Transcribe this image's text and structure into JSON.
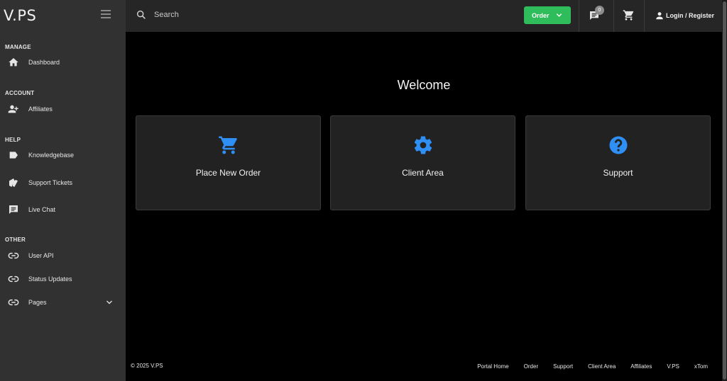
{
  "brand": "V.PS",
  "sidebar": {
    "sections": [
      {
        "label": "MANAGE",
        "items": [
          {
            "label": "Dashboard",
            "icon": "home-icon"
          }
        ]
      },
      {
        "label": "ACCOUNT",
        "items": [
          {
            "label": "Affiliates",
            "icon": "users-add-icon"
          }
        ]
      },
      {
        "label": "HELP",
        "items": [
          {
            "label": "Knowledgebase",
            "icon": "label-icon"
          },
          {
            "label": "Support Tickets",
            "icon": "ticket-icon"
          },
          {
            "label": "Live Chat",
            "icon": "chat-icon"
          }
        ]
      },
      {
        "label": "OTHER",
        "items": [
          {
            "label": "User API",
            "icon": "link-icon"
          },
          {
            "label": "Status Updates",
            "icon": "link-icon"
          },
          {
            "label": "Pages",
            "icon": "link-icon",
            "expandable": true
          }
        ]
      }
    ]
  },
  "topbar": {
    "search_placeholder": "Search",
    "order_label": "Order",
    "messages_badge": "0",
    "login_label": "Login / Register"
  },
  "main": {
    "welcome": "Welcome",
    "cards": [
      {
        "label": "Place New Order",
        "icon": "cart-icon"
      },
      {
        "label": "Client Area",
        "icon": "gear-icon"
      },
      {
        "label": "Support",
        "icon": "help-circle-icon"
      }
    ]
  },
  "footer": {
    "copyright": "© 2025 V.PS",
    "links": [
      "Portal Home",
      "Order",
      "Support",
      "Client Area",
      "Affiliates",
      "V.PS",
      "xTom"
    ]
  },
  "colors": {
    "accent_green": "#2ebd5a",
    "icon_blue": "#2f8ff5",
    "sidebar_bg": "#313131",
    "topbar_bg": "#262626",
    "card_bg": "#222222"
  }
}
